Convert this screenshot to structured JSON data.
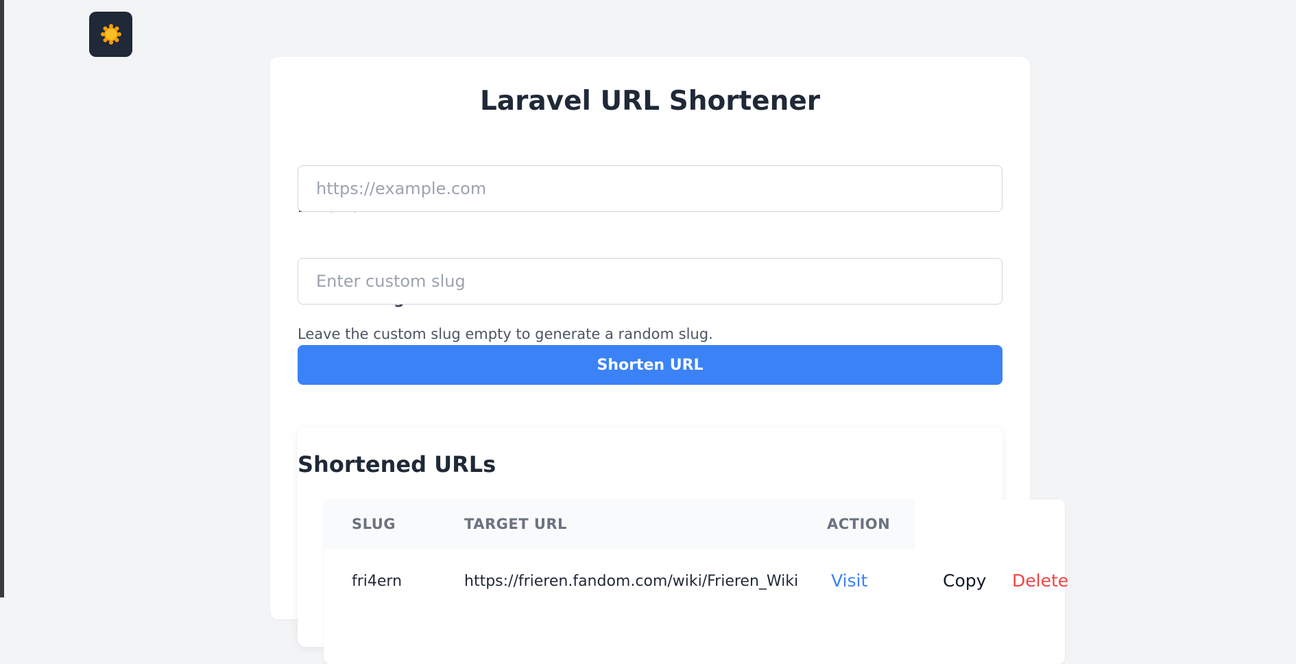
{
  "theme_toggle": {
    "icon": "sun-icon",
    "sun_color": "#f59e0b"
  },
  "title": "Laravel URL Shortener",
  "form": {
    "url_label": "Enter URL",
    "url_placeholder": "https://example.com",
    "url_value": "",
    "slug_label": "Custom Slug",
    "slug_placeholder": "Enter custom slug",
    "slug_value": "",
    "hint": "Leave the custom slug empty to generate a random slug.",
    "submit_label": "Shorten URL",
    "accent_color": "#3b82f6"
  },
  "list": {
    "title": "Shortened URLs",
    "columns": [
      "SLUG",
      "TARGET URL",
      "ACTION"
    ],
    "rows": [
      {
        "slug": "fri4ern",
        "target_url": "https://frieren.fandom.com/wiki/Frieren_Wiki",
        "visit_label": "Visit",
        "copy_label": "Copy",
        "delete_label": "Delete"
      }
    ]
  }
}
